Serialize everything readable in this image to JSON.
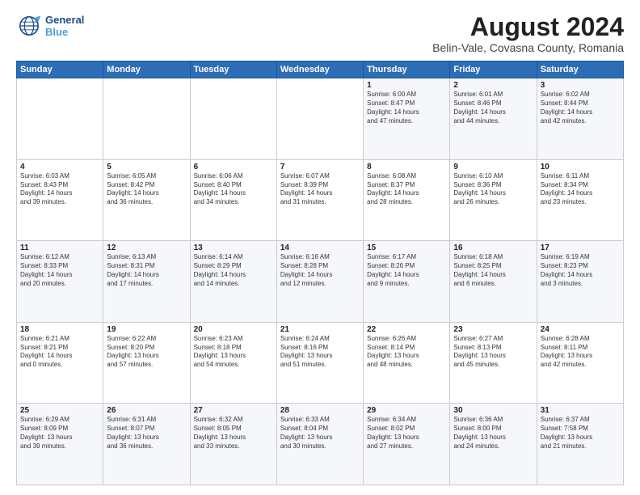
{
  "logo": {
    "line1": "General",
    "line2": "Blue"
  },
  "title": "August 2024",
  "subtitle": "Belin-Vale, Covasna County, Romania",
  "headers": [
    "Sunday",
    "Monday",
    "Tuesday",
    "Wednesday",
    "Thursday",
    "Friday",
    "Saturday"
  ],
  "weeks": [
    [
      {
        "day": "",
        "info": ""
      },
      {
        "day": "",
        "info": ""
      },
      {
        "day": "",
        "info": ""
      },
      {
        "day": "",
        "info": ""
      },
      {
        "day": "1",
        "info": "Sunrise: 6:00 AM\nSunset: 8:47 PM\nDaylight: 14 hours\nand 47 minutes."
      },
      {
        "day": "2",
        "info": "Sunrise: 6:01 AM\nSunset: 8:46 PM\nDaylight: 14 hours\nand 44 minutes."
      },
      {
        "day": "3",
        "info": "Sunrise: 6:02 AM\nSunset: 8:44 PM\nDaylight: 14 hours\nand 42 minutes."
      }
    ],
    [
      {
        "day": "4",
        "info": "Sunrise: 6:03 AM\nSunset: 8:43 PM\nDaylight: 14 hours\nand 39 minutes."
      },
      {
        "day": "5",
        "info": "Sunrise: 6:05 AM\nSunset: 8:42 PM\nDaylight: 14 hours\nand 36 minutes."
      },
      {
        "day": "6",
        "info": "Sunrise: 6:06 AM\nSunset: 8:40 PM\nDaylight: 14 hours\nand 34 minutes."
      },
      {
        "day": "7",
        "info": "Sunrise: 6:07 AM\nSunset: 8:39 PM\nDaylight: 14 hours\nand 31 minutes."
      },
      {
        "day": "8",
        "info": "Sunrise: 6:08 AM\nSunset: 8:37 PM\nDaylight: 14 hours\nand 28 minutes."
      },
      {
        "day": "9",
        "info": "Sunrise: 6:10 AM\nSunset: 8:36 PM\nDaylight: 14 hours\nand 26 minutes."
      },
      {
        "day": "10",
        "info": "Sunrise: 6:11 AM\nSunset: 8:34 PM\nDaylight: 14 hours\nand 23 minutes."
      }
    ],
    [
      {
        "day": "11",
        "info": "Sunrise: 6:12 AM\nSunset: 8:33 PM\nDaylight: 14 hours\nand 20 minutes."
      },
      {
        "day": "12",
        "info": "Sunrise: 6:13 AM\nSunset: 8:31 PM\nDaylight: 14 hours\nand 17 minutes."
      },
      {
        "day": "13",
        "info": "Sunrise: 6:14 AM\nSunset: 8:29 PM\nDaylight: 14 hours\nand 14 minutes."
      },
      {
        "day": "14",
        "info": "Sunrise: 6:16 AM\nSunset: 8:28 PM\nDaylight: 14 hours\nand 12 minutes."
      },
      {
        "day": "15",
        "info": "Sunrise: 6:17 AM\nSunset: 8:26 PM\nDaylight: 14 hours\nand 9 minutes."
      },
      {
        "day": "16",
        "info": "Sunrise: 6:18 AM\nSunset: 8:25 PM\nDaylight: 14 hours\nand 6 minutes."
      },
      {
        "day": "17",
        "info": "Sunrise: 6:19 AM\nSunset: 8:23 PM\nDaylight: 14 hours\nand 3 minutes."
      }
    ],
    [
      {
        "day": "18",
        "info": "Sunrise: 6:21 AM\nSunset: 8:21 PM\nDaylight: 14 hours\nand 0 minutes."
      },
      {
        "day": "19",
        "info": "Sunrise: 6:22 AM\nSunset: 8:20 PM\nDaylight: 13 hours\nand 57 minutes."
      },
      {
        "day": "20",
        "info": "Sunrise: 6:23 AM\nSunset: 8:18 PM\nDaylight: 13 hours\nand 54 minutes."
      },
      {
        "day": "21",
        "info": "Sunrise: 6:24 AM\nSunset: 8:16 PM\nDaylight: 13 hours\nand 51 minutes."
      },
      {
        "day": "22",
        "info": "Sunrise: 6:26 AM\nSunset: 8:14 PM\nDaylight: 13 hours\nand 48 minutes."
      },
      {
        "day": "23",
        "info": "Sunrise: 6:27 AM\nSunset: 8:13 PM\nDaylight: 13 hours\nand 45 minutes."
      },
      {
        "day": "24",
        "info": "Sunrise: 6:28 AM\nSunset: 8:11 PM\nDaylight: 13 hours\nand 42 minutes."
      }
    ],
    [
      {
        "day": "25",
        "info": "Sunrise: 6:29 AM\nSunset: 8:09 PM\nDaylight: 13 hours\nand 39 minutes."
      },
      {
        "day": "26",
        "info": "Sunrise: 6:31 AM\nSunset: 8:07 PM\nDaylight: 13 hours\nand 36 minutes."
      },
      {
        "day": "27",
        "info": "Sunrise: 6:32 AM\nSunset: 8:05 PM\nDaylight: 13 hours\nand 33 minutes."
      },
      {
        "day": "28",
        "info": "Sunrise: 6:33 AM\nSunset: 8:04 PM\nDaylight: 13 hours\nand 30 minutes."
      },
      {
        "day": "29",
        "info": "Sunrise: 6:34 AM\nSunset: 8:02 PM\nDaylight: 13 hours\nand 27 minutes."
      },
      {
        "day": "30",
        "info": "Sunrise: 6:36 AM\nSunset: 8:00 PM\nDaylight: 13 hours\nand 24 minutes."
      },
      {
        "day": "31",
        "info": "Sunrise: 6:37 AM\nSunset: 7:58 PM\nDaylight: 13 hours\nand 21 minutes."
      }
    ]
  ]
}
